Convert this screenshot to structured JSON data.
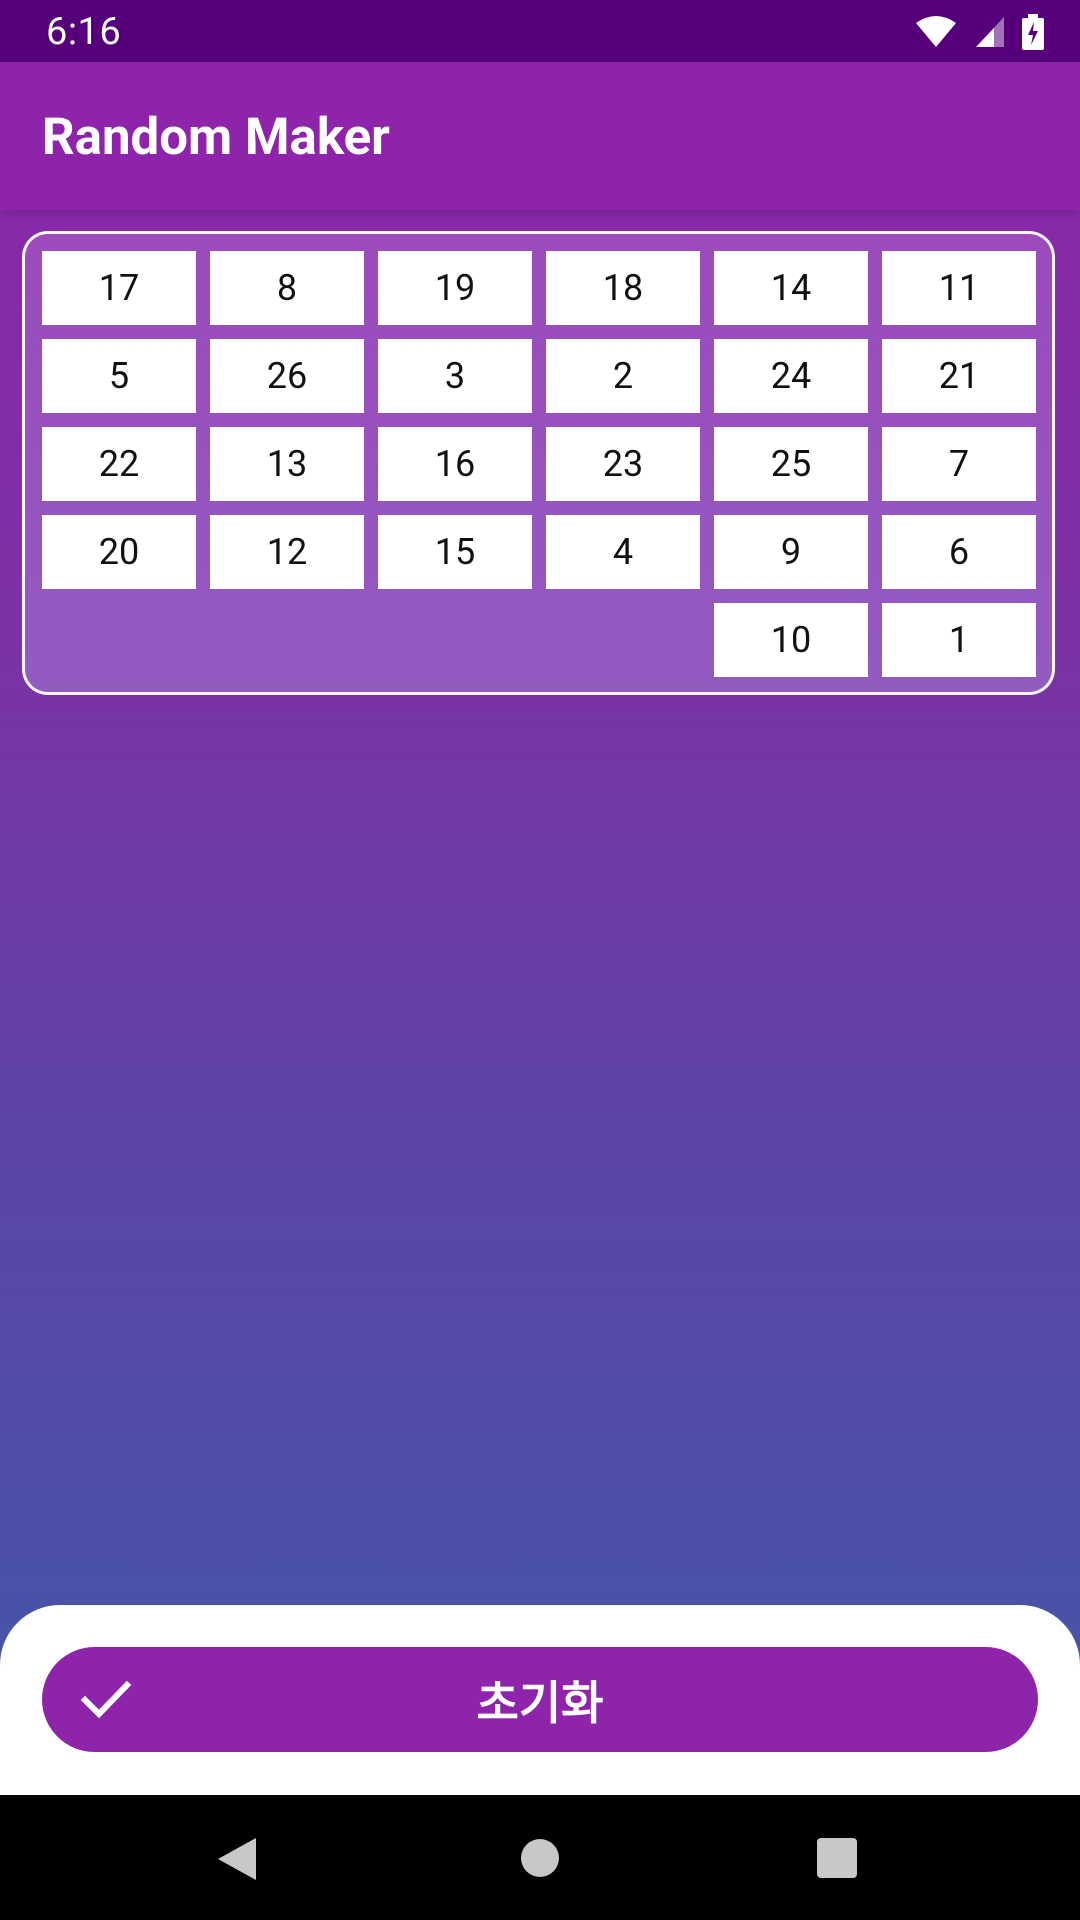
{
  "status_bar": {
    "time": "6:16",
    "icons": [
      "wifi-icon",
      "signal-icon",
      "battery-charging-icon"
    ]
  },
  "app_bar": {
    "title": "Random Maker"
  },
  "grid": {
    "rows": [
      [
        "17",
        "8",
        "19",
        "18",
        "14",
        "11"
      ],
      [
        "5",
        "26",
        "3",
        "2",
        "24",
        "21"
      ],
      [
        "22",
        "13",
        "16",
        "23",
        "25",
        "7"
      ],
      [
        "20",
        "12",
        "15",
        "4",
        "9",
        "6"
      ],
      [
        "",
        "",
        "",
        "",
        "10",
        "1"
      ]
    ]
  },
  "bottom_sheet": {
    "reset_label": "초기화",
    "reset_icon": "check-icon"
  },
  "nav_bar": {
    "buttons": [
      "back-icon",
      "home-icon",
      "recents-icon"
    ]
  },
  "colors": {
    "primary": "#8e24aa",
    "status_bar": "#55007a",
    "gradient_bottom": "#3d5ba8"
  }
}
